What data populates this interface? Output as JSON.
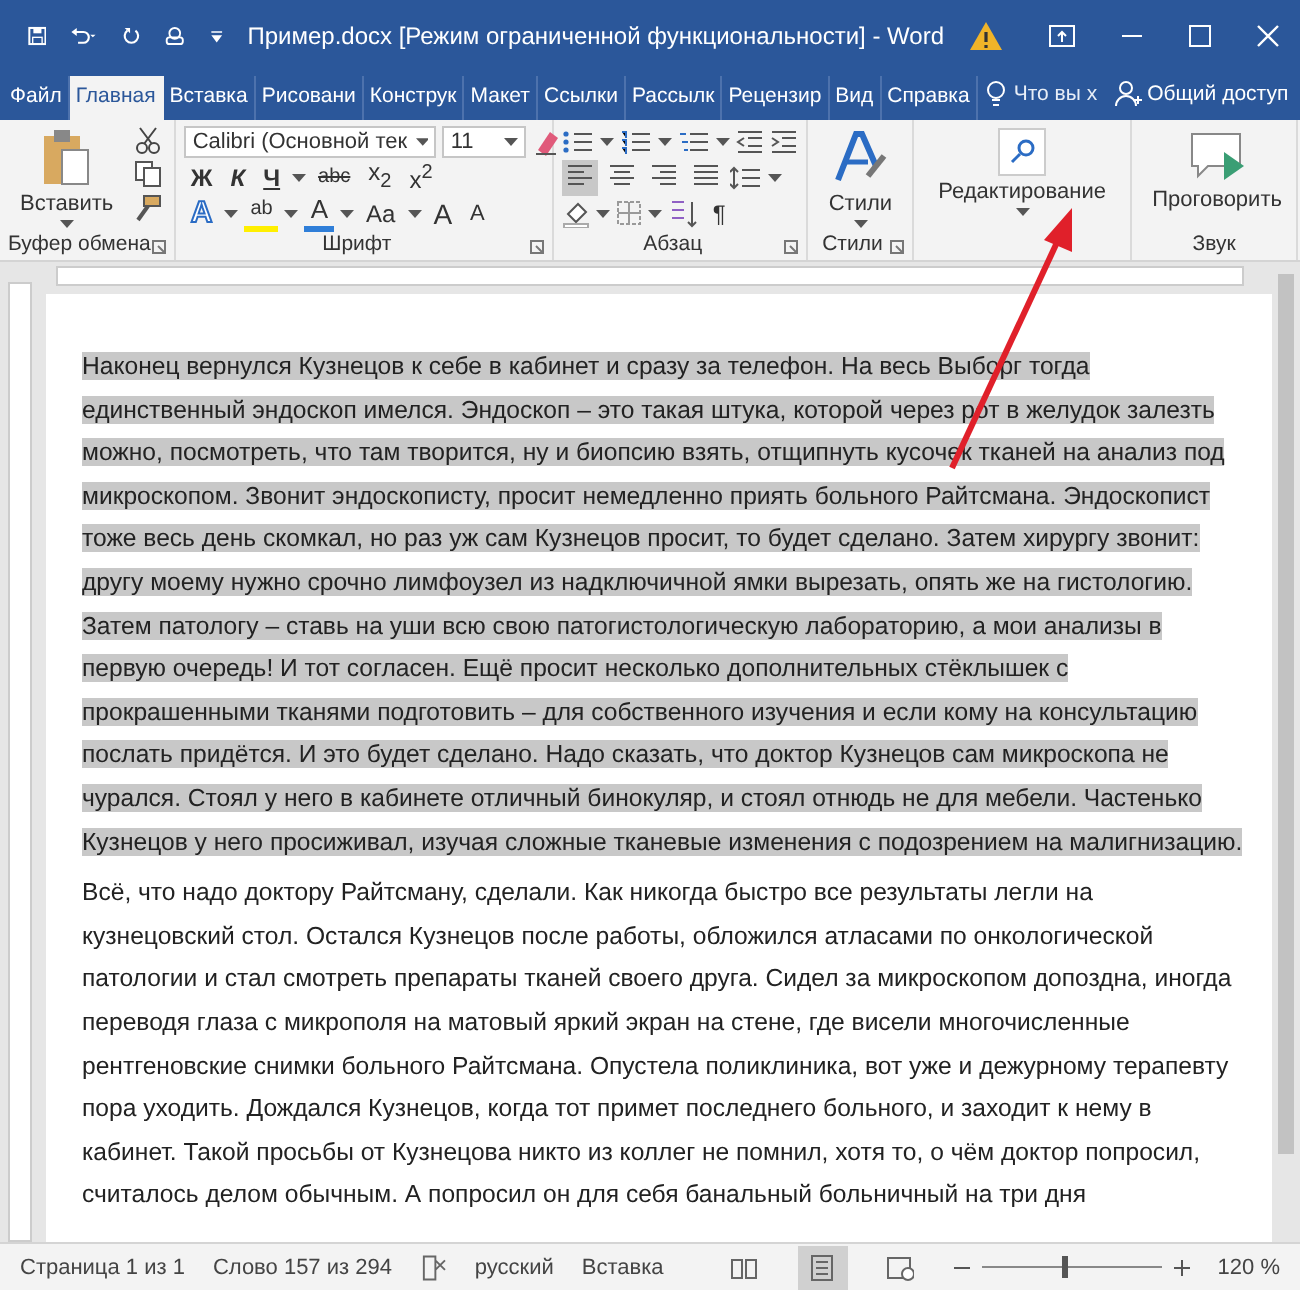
{
  "title_bar": {
    "title": "Пример.docx [Режим ограниченной функциональности]  -  Word"
  },
  "tabs": [
    {
      "label": "Файл",
      "selected": false
    },
    {
      "label": "Главная",
      "selected": true
    },
    {
      "label": "Вставка",
      "selected": false
    },
    {
      "label": "Рисовани",
      "selected": false
    },
    {
      "label": "Конструк",
      "selected": false
    },
    {
      "label": "Макет",
      "selected": false
    },
    {
      "label": "Ссылки",
      "selected": false
    },
    {
      "label": "Рассылк",
      "selected": false
    },
    {
      "label": "Рецензир",
      "selected": false
    },
    {
      "label": "Вид",
      "selected": false
    },
    {
      "label": "Справка",
      "selected": false
    }
  ],
  "tell_me": {
    "placeholder": "Что вы х"
  },
  "share": {
    "label": "Общий доступ"
  },
  "ribbon": {
    "clipboard": {
      "paste": "Вставить",
      "group_label": "Буфер обмена"
    },
    "font": {
      "font_name": "Calibri (Основной тек",
      "font_size": "11",
      "group_label": "Шрифт",
      "format_buttons": [
        {
          "kind": "bold",
          "label": "Ж"
        },
        {
          "kind": "italic",
          "label": "К"
        },
        {
          "kind": "underline",
          "label": "Ч"
        },
        {
          "kind": "strike",
          "label": "abc"
        },
        {
          "kind": "sub",
          "label": "x$_{2}$"
        },
        {
          "kind": "sup",
          "label": "x$^{2}$"
        }
      ],
      "effect_buttons": [
        {
          "kind": "effects",
          "label": "A"
        },
        {
          "kind": "highlight",
          "label": "ab"
        },
        {
          "kind": "color",
          "label": "A"
        },
        {
          "kind": "case",
          "label": "Aa"
        },
        {
          "kind": "grow",
          "label": "A"
        },
        {
          "kind": "shrink",
          "label": "A"
        }
      ]
    },
    "paragraph": {
      "group_label": "Абзац",
      "mark": "¶",
      "alignments": [
        {
          "selected": true
        },
        {
          "selected": false
        },
        {
          "selected": false
        },
        {
          "selected": false
        }
      ]
    },
    "styles": {
      "button": "Стили",
      "group_label": "Стили"
    },
    "editing": {
      "button": "Редактирование"
    },
    "voice": {
      "button": "Проговорить",
      "group_label": "Звук"
    }
  },
  "document": {
    "paragraphs": [
      {
        "selected": true,
        "text": "Наконец вернулся Кузнецов к себе в кабинет и сразу за телефон. На весь Выборг тогда единственный эндоскоп имелся. Эндоскоп – это такая штука, которой через рот в желудок залезть можно, посмотреть, что там творится, ну и биопсию взять, отщипнуть кусочек тканей на анализ под микроскопом. Звонит эндоскописту, просит немедленно приять больного Райтсмана. Эндоскопист тоже весь день скомкал, но раз уж сам Кузнецов просит, то будет сделано. Затем хирургу звонит: другу моему нужно срочно лимфоузел из надключичной ямки вырезать, опять же на гистологию. Затем патологу – ставь на уши всю свою патогистологическую лабораторию, а мои анализы в первую очередь! И тот согласен. Ещё просит несколько дополнительных стёклышек с прокрашенными тканями подготовить – для собственного изучения и если кому на консультацию послать придётся. И это будет сделано. Надо сказать, что доктор Кузнецов сам микроскопа не чурался. Стоял у него в кабинете отличный бинокуляр, и стоял отнюдь не для мебели. Частенько Кузнецов у него просиживал, изучая сложные тканевые изменения с подозрением на малигнизацию."
      },
      {
        "selected": false,
        "text": "Всё, что надо доктору Райтсману, сделали. Как никогда быстро все результаты легли на кузнецовский стол. Остался Кузнецов после работы, обложился атласами по онкологической патологии и стал смотреть препараты тканей своего друга. Сидел за микроскопом допоздна, иногда переводя глаза с микрополя на матовый яркий экран на стене, где висели многочисленные рентгеновские снимки больного Райтсмана. Опустела поликлиника, вот уже и дежурному терапевту пора уходить. Дождался Кузнецов, когда тот примет последнего больного, и заходит к нему в кабинет. Такой просьбы от Кузнецова никто из коллег не помнил, хотя то, о чём доктор попросил, считалось делом обычным. А попросил он для себя банальный больничный на три дня"
      }
    ]
  },
  "status_bar": {
    "page": "Страница 1 из 1",
    "words": "Слово 157 из 294",
    "language": "русский",
    "mode": "Вставка",
    "views": [
      {
        "kind": "read",
        "selected": false
      },
      {
        "kind": "print",
        "selected": true
      },
      {
        "kind": "web",
        "selected": false
      }
    ],
    "zoom": {
      "level": 0.45,
      "reading": "120 %"
    }
  }
}
